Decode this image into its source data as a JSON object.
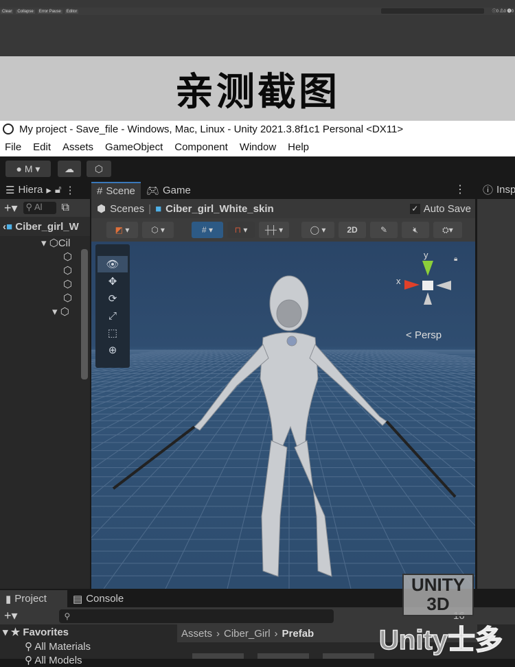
{
  "console_panel": {
    "tab": "Console",
    "buttons": [
      "Clear",
      "Collapse",
      "Error Pause",
      "Editor"
    ],
    "counts": [
      "0",
      "0",
      "0"
    ]
  },
  "banner": "亲测截图",
  "window_title": "My project - Save_file - Windows, Mac, Linux - Unity 2021.3.8f1c1 Personal <DX11>",
  "menu": [
    "File",
    "Edit",
    "Assets",
    "GameObject",
    "Component",
    "Window",
    "Help"
  ],
  "toolbar": {
    "account": "M"
  },
  "hierarchy": {
    "tab": "Hiera",
    "search_placeholder": "Al",
    "root": "Ciber_girl_W",
    "child": "Cil"
  },
  "scene": {
    "tabs": [
      "Scene",
      "Game"
    ],
    "breadcrumb": [
      "Scenes",
      "Ciber_girl_White_skin"
    ],
    "auto_save": "Auto Save",
    "auto_save_checked": true,
    "mode_2d": "2D",
    "gizmo": {
      "y": "y",
      "x": "x",
      "persp": "Persp"
    }
  },
  "inspector": {
    "tab": "Insp"
  },
  "project": {
    "tabs": [
      "Project",
      "Console"
    ],
    "favorites": "Favorites",
    "fav_items": [
      "All Materials",
      "All Models"
    ],
    "path": [
      "Assets",
      "Ciber_Girl",
      "Prefab"
    ],
    "count": "16"
  },
  "watermark": {
    "line1": "UNITY",
    "line2": "3D",
    "line3": "Unity士多"
  }
}
